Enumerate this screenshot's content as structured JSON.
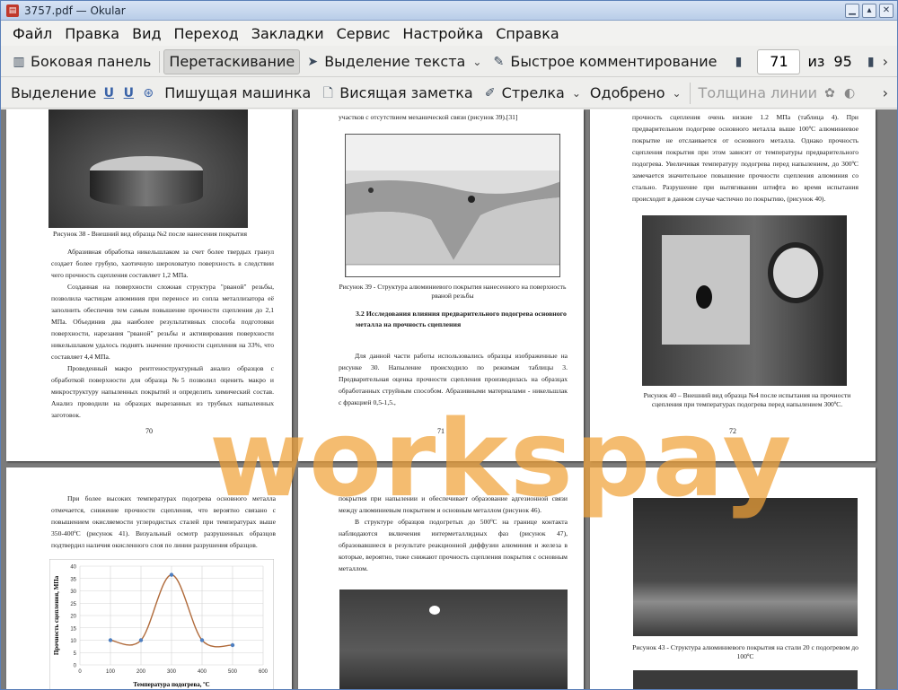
{
  "window": {
    "title": "3757.pdf — Okular",
    "app_icon": "pdf-icon"
  },
  "menu": [
    "Файл",
    "Правка",
    "Вид",
    "Переход",
    "Закладки",
    "Сервис",
    "Настройка",
    "Справка"
  ],
  "toolbar1": {
    "sidebar": "Боковая панель",
    "browse": "Перетаскивание",
    "text_select": "Выделение текста",
    "quick_annot": "Быстрое комментирование",
    "page_current": "71",
    "of": "из",
    "page_total": "95"
  },
  "toolbar2": {
    "select": "Выделение",
    "typewriter": "Пишущая машинка",
    "note": "Висящая заметка",
    "arrow": "Стрелка",
    "stamp": "Одобрено",
    "line_width": "Толщина линии"
  },
  "pages": {
    "p70": {
      "cap": "Рисунок 38 - Внешний вид образца №2 после нанесения покрытия",
      "t1": "Абразивная обработка никельшлаком за счет более твердых гранул создает более грубую, хаотичную шероховатую поверхность в следствии чего прочность сцепления составляет 1,2 МПа.",
      "t2": "Созданная на поверхности сложная структура \"рваной\" резьбы, позволила частицам алюминия при переносе из сопла металлизатора её заполнить обеспечив тем самым повышение прочности сцепления до 2,1 МПа. Объединив два наиболее результативных способа подготовки поверхности, нарезания \"рваной\" резьбы и активирования поверхности никельшлаком удалось поднять значение прочности сцепления на 33%, что составляет 4,4 МПа.",
      "t3": "Проведенный макро рентгеноструктурный анализ образцов с обработкой поверхности для образца №5 позволил оценить макро и микроструктуру напыленных покрытий и определить химический состав. Анализ проводили на образцах вырезанных из трубных напыленных заготовок.",
      "num": "70"
    },
    "p71": {
      "top": "участков с отсутствием механической связи (рисунок 39).[31]",
      "cap": "Рисунок 39 - Структура алюминиевого покрытия нанесенного на поверхность рваной резьбы",
      "h": "3.2 Исследования влияния предварительного подогрева основного металла на прочность сцепления",
      "t1": "Для данной части работы использовались образцы изображенные на рисунке 30. Напыление происходило по режимам таблицы 3. Предварительная оценка прочности сцепления производилась на образцах обработанных струйным способом. Абразивными материалами - никельшлак с фракцией 0,5-1,5.,",
      "num": "71"
    },
    "p72": {
      "t1": "прочность сцепления очень низкие 1.2 МПа (таблица 4). При предварительном подогреве основного металла выше 100ºС алюминиевое покрытие не отслаивается от основного металла. Однако прочность сцепления покрытия при этом зависит от температуры предварительного подогрева. Увеличивая температуру подогрева перед напылением, до 300ºС замечается значительное повышение прочности сцепления алюминия со стально. Разрушение при вытягивании штифта во время испытания происходит в данном случае частично по покрытию, (рисунок 40).",
      "cap": "Рисунок 40 – Внешний вид образца №4 после испытания на прочности сцепления при температурах подогрева перед напылением 300ºС.",
      "num": "72"
    },
    "p73": {
      "t1": "При более высоких температурах подогрева основного металла отмечается, снижение прочности сцепления, что вероятно связано с повышением окисляемости углеродистых сталей при температурах выше 350-400ºС (рисунок 41). Визуальный осмотр разрушенных образцов подтвердил наличия окисленного слоя по линии разрушения образцов."
    },
    "p74": {
      "t1": "покрытия при напылении и обеспечивает образование адгезионной связи между алюминиевым покрытием и основным металлом (рисунок 46).",
      "t2": "В структуре образцов подогретых до 500ºС на границе контакта наблюдаются включения интерметаллидных фаз (рисунок 47), образовавшиеся в результате реакционной диффузии алюминия и железа в которые, вероятно, тоже снижают прочность сцепления покрытия с основным металлом."
    },
    "p75": {
      "cap": "Рисунок 43 - Структура алюминиевого покрытия на стали 20 с подогревом до 100ºС"
    }
  },
  "watermark": "workspay",
  "chart_data": {
    "type": "line",
    "x": [
      100,
      200,
      300,
      400,
      500
    ],
    "values": [
      10,
      10,
      36.5,
      10,
      8
    ],
    "ylabel": "Прочность сцепления, МПа",
    "xlabel": "Температура подогрева, ºС",
    "xlim": [
      0,
      600
    ],
    "ylim": [
      0,
      40
    ],
    "xticks": [
      0,
      100,
      200,
      300,
      400,
      500,
      600
    ],
    "yticks": [
      0,
      5,
      10,
      15,
      20,
      25,
      30,
      35,
      40
    ],
    "grid": true,
    "line_color": "#b06a3a",
    "marker_color": "#4f7fc0"
  }
}
